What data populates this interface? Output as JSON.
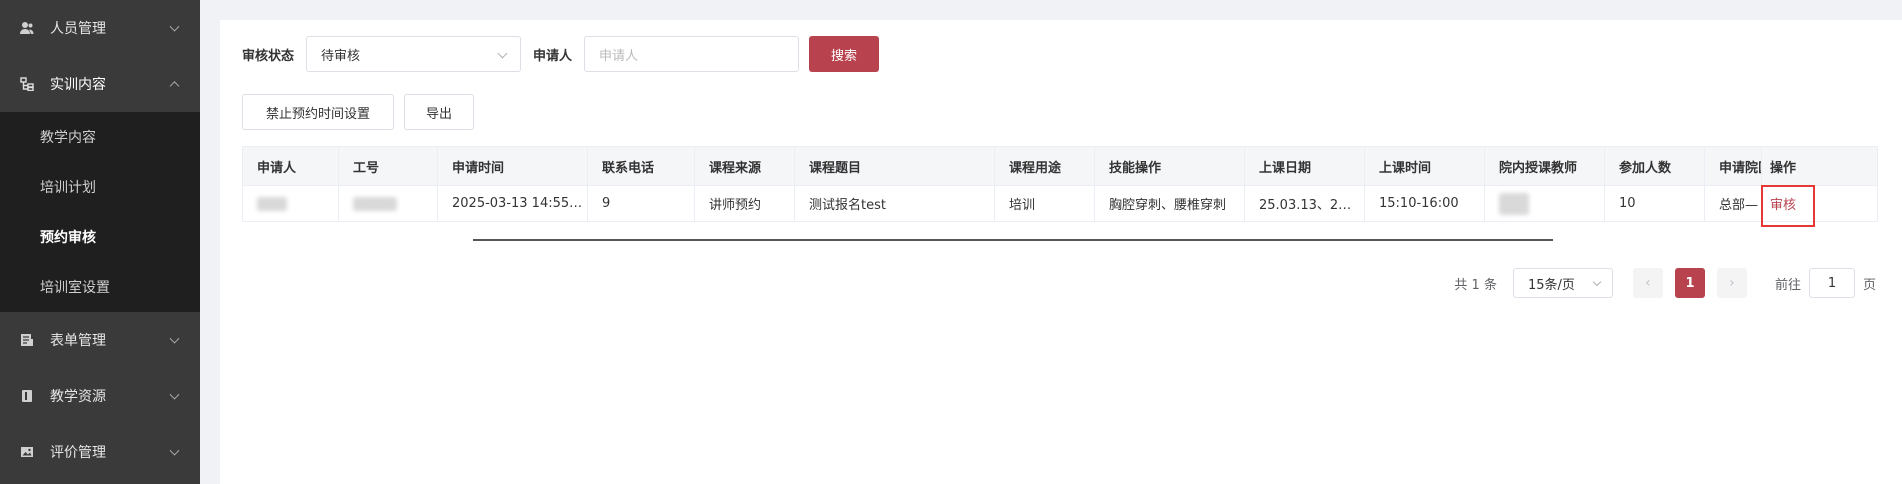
{
  "sidebar": {
    "items": [
      {
        "label": "人员管理",
        "icon": "users-icon"
      },
      {
        "label": "实训内容",
        "icon": "tree-icon",
        "open": true,
        "children": [
          "教学内容",
          "培训计划",
          "预约审核",
          "培训室设置"
        ],
        "active_child": "预约审核"
      },
      {
        "label": "表单管理",
        "icon": "form-icon"
      },
      {
        "label": "教学资源",
        "icon": "book-icon"
      },
      {
        "label": "评价管理",
        "icon": "image-icon"
      }
    ]
  },
  "filters": {
    "status_label": "审核状态",
    "status_value": "待审核",
    "applicant_label": "申请人",
    "applicant_placeholder": "申请人",
    "search_label": "搜索"
  },
  "toolbar": {
    "disable_time_label": "禁止预约时间设置",
    "export_label": "导出"
  },
  "table": {
    "columns": [
      "申请人",
      "工号",
      "申请时间",
      "联系电话",
      "课程来源",
      "课程题目",
      "课程用途",
      "技能操作",
      "上课日期",
      "上课时间",
      "院内授课教师",
      "参加人数",
      "申请院区",
      "操作"
    ],
    "rows": [
      {
        "applicant": "",
        "job_no": "",
        "apply_time": "2025-03-13 14:55…",
        "phone": "9",
        "source": "讲师预约",
        "topic": "测试报名test",
        "usage": "培训",
        "skills": "胸腔穿刺、腰椎穿刺",
        "date": "25.03.13、2…",
        "time": "15:10-16:00",
        "teacher": "",
        "count": "10",
        "campus": "总部—",
        "action": "审核"
      }
    ]
  },
  "pagination": {
    "total": "共 1 条",
    "page_size": "15条/页",
    "prev": "‹",
    "current": "1",
    "next": "›",
    "jump_prefix": "前往",
    "jump_value": "1",
    "jump_suffix": "页"
  },
  "colors": {
    "accent": "#b8434f",
    "sidebar_bg": "#3a3a3a",
    "submenu_bg": "#1f1f1f",
    "highlight": "#e53935"
  }
}
